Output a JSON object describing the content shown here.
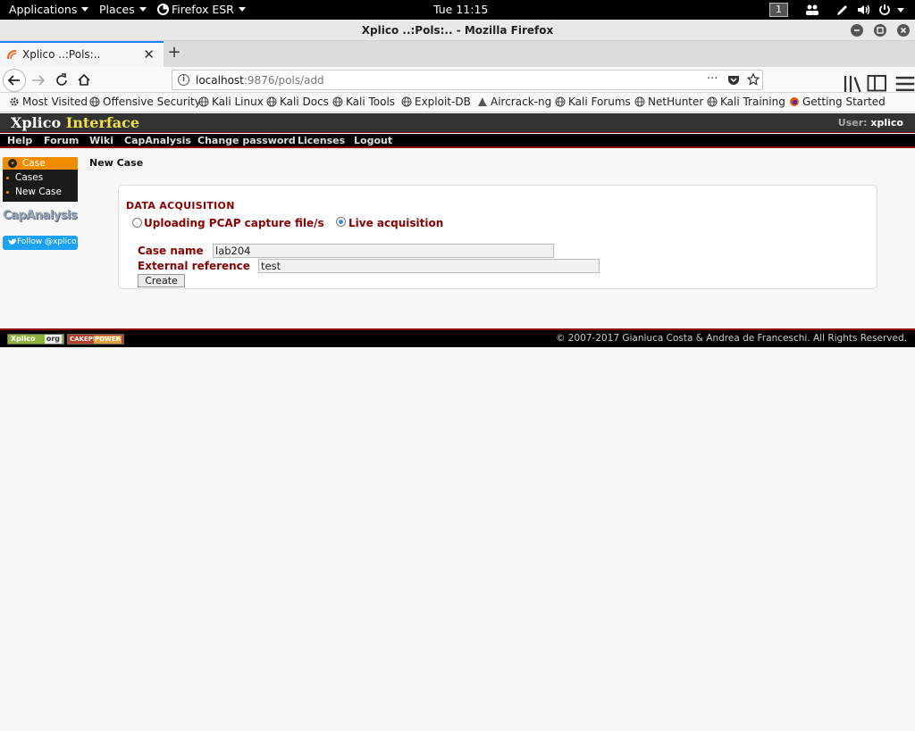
{
  "system_bar": {
    "applications": "Applications",
    "places": "Places",
    "firefox": "Firefox ESR",
    "clock": "Tue 11:15",
    "workspace": "1"
  },
  "window": {
    "title": "Xplico ..:Pols:.. - Mozilla Firefox"
  },
  "tab": {
    "title": "Xplico ..:Pols:..",
    "new_tab": "+"
  },
  "url": {
    "host": "localhost",
    "path": ":9876/pols/add",
    "more": "···"
  },
  "bookmarks": [
    {
      "label": "Most Visited",
      "icon": "gear-icon"
    },
    {
      "label": "Offensive Security",
      "icon": "globe-icon"
    },
    {
      "label": "Kali Linux",
      "icon": "globe-icon"
    },
    {
      "label": "Kali Docs",
      "icon": "globe-icon"
    },
    {
      "label": "Kali Tools",
      "icon": "globe-icon"
    },
    {
      "label": "Exploit-DB",
      "icon": "globe-icon"
    },
    {
      "label": "Aircrack-ng",
      "icon": "aircrack-icon"
    },
    {
      "label": "Kali Forums",
      "icon": "globe-icon"
    },
    {
      "label": "NetHunter",
      "icon": "globe-icon"
    },
    {
      "label": "Kali Training",
      "icon": "globe-icon"
    },
    {
      "label": "Getting Started",
      "icon": "firefox-icon"
    }
  ],
  "xplico": {
    "title_a": "Xplico",
    "title_b": "Interface",
    "user_label": "User:",
    "user_name": "xplico",
    "menu": [
      "Help",
      "Forum",
      "Wiki",
      "CapAnalysis",
      "Change password",
      "Licenses",
      "Logout"
    ],
    "sidebar": {
      "header": "Case",
      "items": [
        "Cases",
        "New Case"
      ],
      "capanalysis": "CapAnalysis",
      "follow": "Follow @xplico"
    },
    "heading": "New Case",
    "form": {
      "section_title": "DATA ACQUISITION",
      "radio_upload": "Uploading PCAP capture file/s",
      "radio_live": "Live acquisition",
      "selected": "live",
      "case_name_label": "Case name",
      "case_name_value": "lab204",
      "ext_ref_label": "External reference",
      "ext_ref_value": "test",
      "create": "Create"
    },
    "footer": {
      "badge_xplico": "Xplico",
      "badge_org": "org",
      "badge_cake": "CAKEPHP",
      "badge_power": "POWER",
      "copyright": "© 2007-2017 Gianluca Costa & Andrea de Franceschi. All Rights Reserved."
    }
  },
  "colors": {
    "xplico_red": "#8a0000",
    "sidebar_orange": "#f08c00",
    "twitter_blue": "#1da1f2",
    "firefox_accent": "#0a84ff"
  }
}
